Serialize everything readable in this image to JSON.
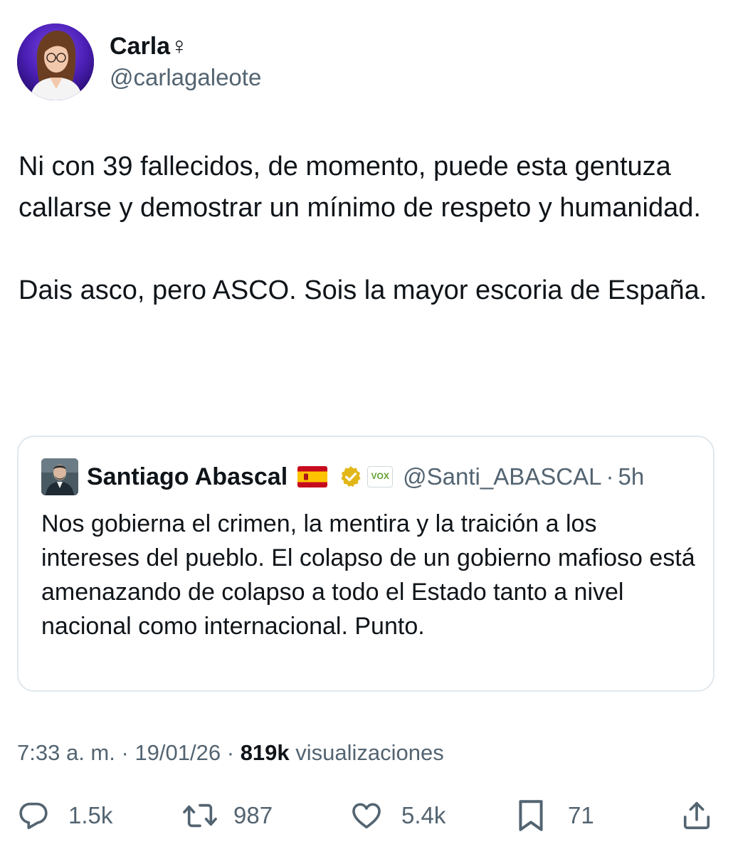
{
  "author": {
    "display_name": "Carla♀",
    "handle": "@carlagaleote"
  },
  "tweet": {
    "paragraphs": [
      "Ni con 39 fallecidos, de momento, puede esta gentuza callarse y demostrar un mínimo de respeto y humanidad.",
      "Dais asco, pero ASCO. Sois la mayor escoria de España."
    ]
  },
  "quote": {
    "display_name": "Santiago Abascal",
    "badge_text": "VOX",
    "handle": "@Santi_ABASCAL",
    "separator": "·",
    "time": "5h",
    "text": "Nos gobierna el crimen, la mentira y la traición a los intereses del pueblo. El colapso de un gobierno mafioso está amenazando de colapso a todo el Estado tanto a nivel nacional como internacional. Punto."
  },
  "meta": {
    "time": "7:33 a. m.",
    "separator": "·",
    "date": "19/01/26",
    "views_count": "819k",
    "views_label": "visualizaciones"
  },
  "actions": {
    "replies": "1.5k",
    "reposts": "987",
    "likes": "5.4k",
    "bookmarks": "71"
  },
  "icons": {
    "reply": "reply-icon",
    "repost": "repost-icon",
    "like": "heart-icon",
    "bookmark": "bookmark-icon",
    "share": "share-icon",
    "verified": "verified-badge-icon",
    "flag": "spain-flag-icon"
  },
  "colors": {
    "text": "#0f1419",
    "secondary": "#536471",
    "border": "#e1e8ed",
    "verified_gold": "#e2b719",
    "vox_green": "#5ea02f"
  }
}
